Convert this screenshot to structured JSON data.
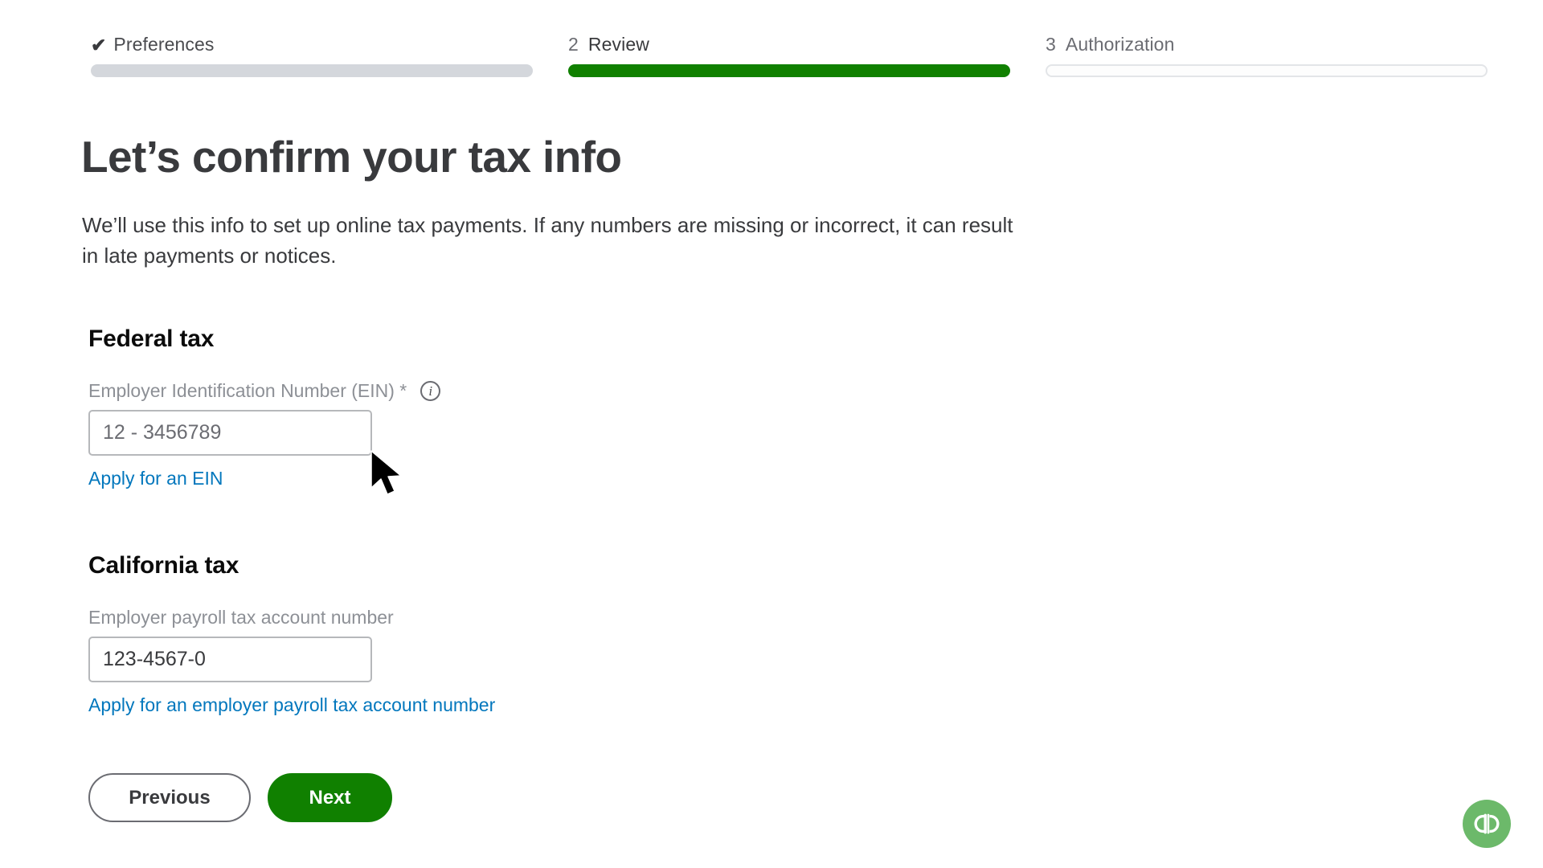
{
  "stepper": {
    "steps": [
      {
        "marker": "✔",
        "label": "Preferences",
        "state": "completed",
        "bar_color": "#d4d7dc"
      },
      {
        "marker": "2",
        "label": "Review",
        "state": "current",
        "bar_color": "#108000"
      },
      {
        "marker": "3",
        "label": "Authorization",
        "state": "upcoming",
        "bar_color": "#ffffff"
      }
    ]
  },
  "page": {
    "title": "Let’s confirm your tax info",
    "subtitle": "We’ll use this info to set up online tax payments. If any numbers are missing or incorrect, it can result in late payments or notices."
  },
  "federal": {
    "heading": "Federal tax",
    "field_label": "Employer Identification Number (EIN) *",
    "info_icon": "info-icon",
    "info_glyph": "i",
    "input_value": "12 - 3456789",
    "input_placeholder": "12 - 3456789",
    "link_label": "Apply for an EIN"
  },
  "state": {
    "heading": "California tax",
    "field_label": "Employer payroll tax account number",
    "input_value": "123-4567-0",
    "input_placeholder": "123-4567-0",
    "link_label": "Apply for an employer payroll tax account number"
  },
  "actions": {
    "previous_label": "Previous",
    "next_label": "Next"
  },
  "branding": {
    "logo_name": "quickbooks-logo",
    "logo_color": "#6cb96a"
  },
  "colors": {
    "accent_green": "#108000",
    "link_blue": "#0277bd",
    "text_dark": "#393a3d",
    "text_muted": "#8d9096",
    "border_gray": "#b6b8bb"
  }
}
